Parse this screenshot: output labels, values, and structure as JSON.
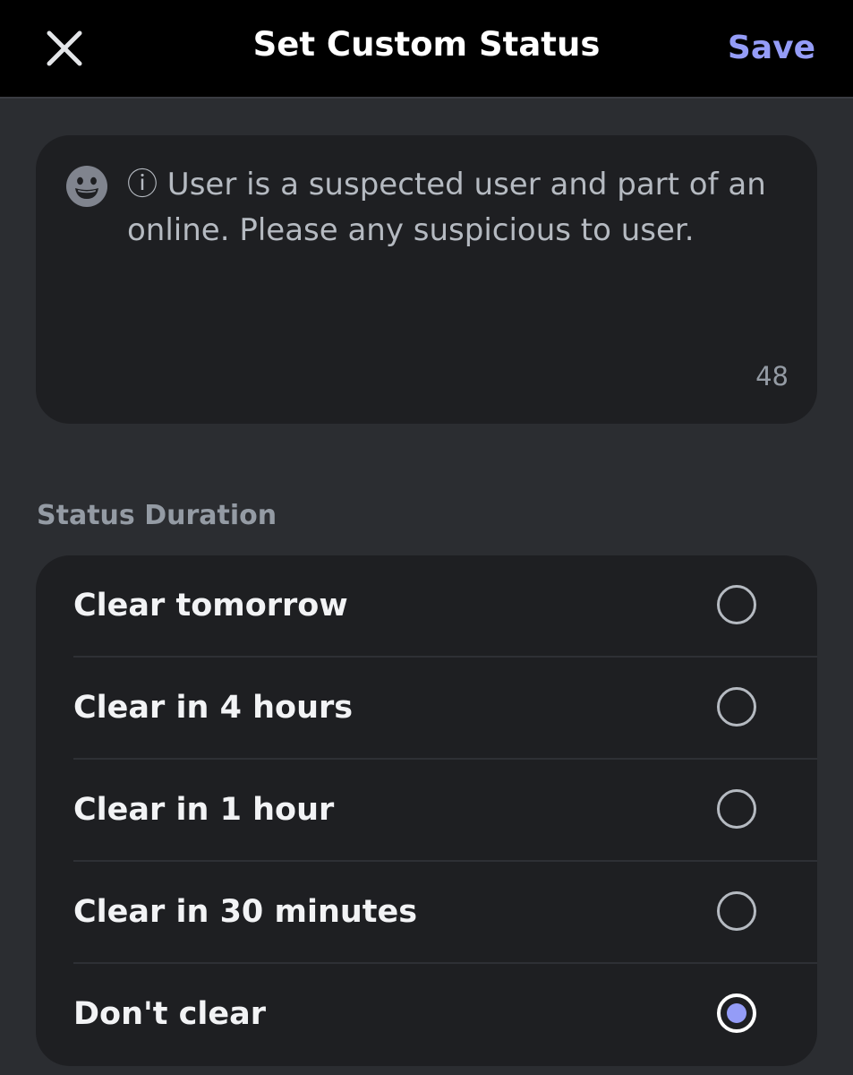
{
  "header": {
    "title": "Set Custom Status",
    "save_label": "Save"
  },
  "status": {
    "text": "ⓘ User is a suspected user and part of an online. Please any suspicious to user.",
    "char_count": "48"
  },
  "duration": {
    "section_label": "Status Duration",
    "options": [
      {
        "label": "Clear tomorrow",
        "selected": false
      },
      {
        "label": "Clear in 4 hours",
        "selected": false
      },
      {
        "label": "Clear in 1 hour",
        "selected": false
      },
      {
        "label": "Clear in 30 minutes",
        "selected": false
      },
      {
        "label": "Don't clear",
        "selected": true
      }
    ]
  },
  "colors": {
    "accent": "#949cf7",
    "header_bg": "#000000",
    "page_bg": "#2b2d31",
    "card_bg": "#1e1f22"
  },
  "icons": {
    "close": "close-icon",
    "emoji": "emoji-icon",
    "radio": "radio-icon"
  }
}
